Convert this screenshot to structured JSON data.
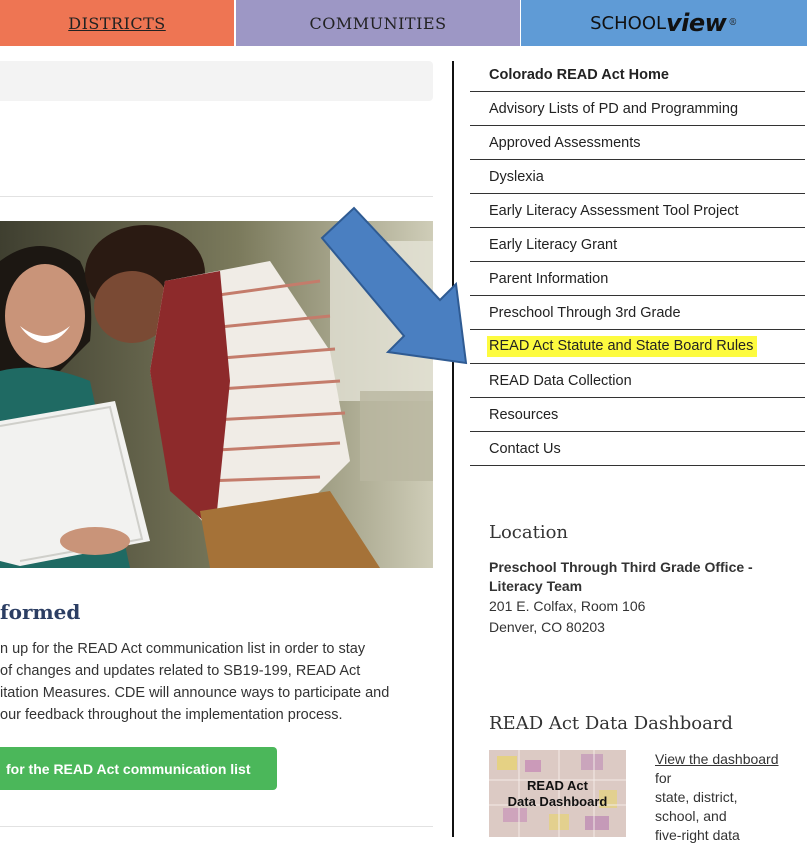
{
  "topnav": {
    "districts": "DISTRICTS",
    "communities": "COMMUNITIES",
    "schoolview_prefix": "SCHOOL",
    "schoolview_suffix": "view",
    "schoolview_mark": "®"
  },
  "main": {
    "section_heading": "formed",
    "paragraph_lines": [
      "n up for the READ Act communication list in order to stay",
      "of changes and updates related to SB19-199, READ Act",
      "itation Measures. CDE will announce ways to participate and",
      "our feedback throughout the implementation process."
    ],
    "signup_button": "for the READ Act communication list"
  },
  "sidebar": {
    "items": [
      {
        "label": "Colorado READ Act Home"
      },
      {
        "label": "Advisory Lists of PD and Programming"
      },
      {
        "label": "Approved Assessments"
      },
      {
        "label": "Dyslexia"
      },
      {
        "label": "Early Literacy Assessment Tool Project"
      },
      {
        "label": "Early Literacy Grant"
      },
      {
        "label": "Parent Information"
      },
      {
        "label": "Preschool Through 3rd Grade"
      },
      {
        "label": "READ Act Statute and State Board Rules"
      },
      {
        "label": "READ Data Collection"
      },
      {
        "label": "Resources"
      },
      {
        "label": "Contact Us"
      }
    ],
    "highlight_color": "#fdfb3f"
  },
  "location": {
    "title": "Location",
    "office": "Preschool Through Third Grade Office - Literacy Team",
    "address1": "201 E. Colfax, Room 106",
    "address2": "Denver, CO 80203"
  },
  "dashboard": {
    "title": "READ Act Data Dashboard",
    "thumb_label_1": "READ Act",
    "thumb_label_2": "Data Dashboard",
    "link_text": "View the dashboard",
    "desc_1": "for",
    "desc_2": "state, district,",
    "desc_3": "school, and",
    "desc_4": "five-right data"
  },
  "colors": {
    "districts": "#ee7553",
    "communities": "#9d97c5",
    "schoolview": "#5f9bd6",
    "button": "#4bb75a",
    "arrow": "#4a7fc1"
  }
}
